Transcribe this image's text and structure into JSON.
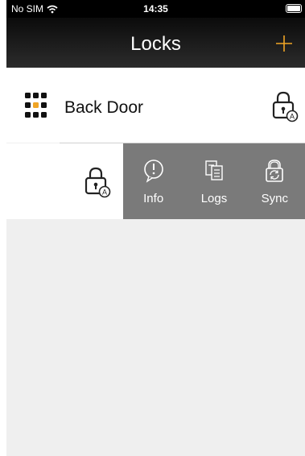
{
  "status_bar": {
    "carrier": "No SIM",
    "time": "14:35"
  },
  "nav": {
    "title": "Locks",
    "add_icon": "plus-icon"
  },
  "colors": {
    "accent": "#f0a526",
    "action_bg": "#7a7a7a",
    "nav_bg": "#1a1a1a"
  },
  "locks": [
    {
      "name": "Back Door",
      "icon": "lock-auto-icon"
    }
  ],
  "actions": [
    {
      "label": "Info",
      "icon": "info-icon"
    },
    {
      "label": "Logs",
      "icon": "logs-icon"
    },
    {
      "label": "Sync",
      "icon": "sync-lock-icon"
    }
  ]
}
